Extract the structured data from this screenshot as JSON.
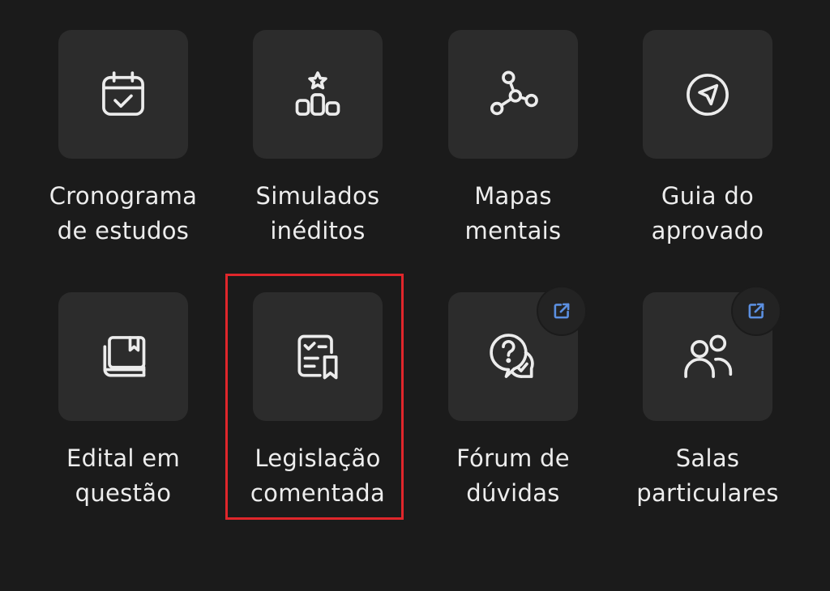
{
  "items": [
    {
      "line1": "Cronograma",
      "line2": "de estudos",
      "icon": "calendar-check-icon"
    },
    {
      "line1": "Simulados",
      "line2": "inéditos",
      "icon": "ranking-star-icon"
    },
    {
      "line1": "Mapas",
      "line2": "mentais",
      "icon": "mind-map-icon"
    },
    {
      "line1": "Guia do",
      "line2": "aprovado",
      "icon": "navigation-icon"
    },
    {
      "line1": "Edital em",
      "line2": "questão",
      "icon": "book-icon"
    },
    {
      "line1": "Legislação",
      "line2": "comentada",
      "icon": "document-bookmark-icon"
    },
    {
      "line1": "Fórum de",
      "line2": "dúvidas",
      "icon": "question-chat-icon",
      "external": true
    },
    {
      "line1": "Salas",
      "line2": "particulares",
      "icon": "users-icon",
      "external": true
    }
  ],
  "external_link_icon": "external-link-icon",
  "colors": {
    "background": "#1b1b1b",
    "tile": "#2c2c2c",
    "text": "#ededed",
    "external_icon": "#5b8fe0",
    "highlight": "#e0262b"
  }
}
